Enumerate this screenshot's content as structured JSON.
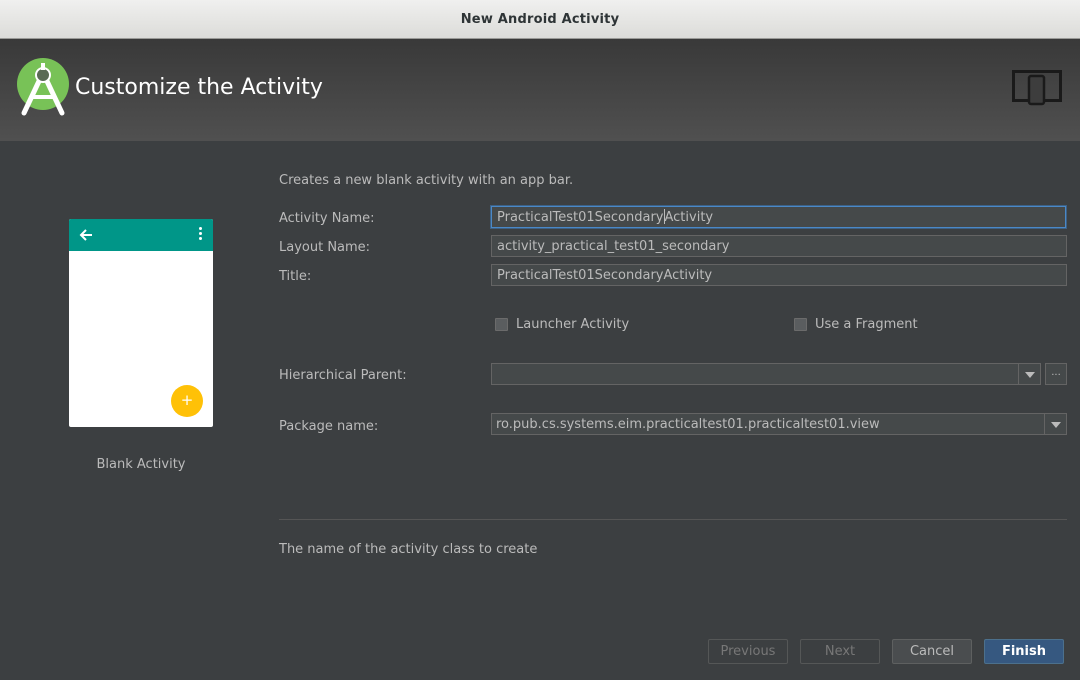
{
  "window": {
    "title": "New Android Activity"
  },
  "header": {
    "title": "Customize the Activity"
  },
  "template": {
    "label": "Blank Activity"
  },
  "form": {
    "description": "Creates a new blank activity with an app bar.",
    "activity_name_label": "Activity Name:",
    "activity_name_value_before": "PracticalTest01Secondary",
    "activity_name_value_after": "Activity",
    "layout_name_label": "Layout Name:",
    "layout_name_value": "activity_practical_test01_secondary",
    "title_label": "Title:",
    "title_value": "PracticalTest01SecondaryActivity",
    "launcher_activity_label": "Launcher Activity",
    "use_fragment_label": "Use a Fragment",
    "hierarchical_parent_label": "Hierarchical Parent:",
    "hierarchical_parent_value": "",
    "browse_button_label": "...",
    "package_name_label": "Package name:",
    "package_name_value": "ro.pub.cs.systems.eim.practicaltest01.practicaltest01.view"
  },
  "help_text": "The name of the activity class to create",
  "buttons": {
    "previous": "Previous",
    "next": "Next",
    "cancel": "Cancel",
    "finish": "Finish"
  },
  "colors": {
    "app_bar": "#009688",
    "fab": "#ffc107",
    "logo_green": "#78c257",
    "primary_button": "#365880",
    "focus_border": "#4a88c7"
  }
}
